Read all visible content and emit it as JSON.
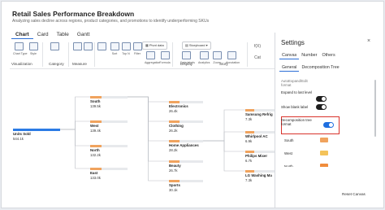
{
  "header": {
    "title": "Retail Sales Performance Breakdown",
    "subtitle": "Analyzing sales decline across regions, product categories, and promotions to identify underperforming SKUs"
  },
  "view_tabs": [
    "Chart",
    "Card",
    "Table",
    "Gantt"
  ],
  "toolbar": {
    "buttons": [
      "Chart Type",
      "Style",
      "Scale",
      "Sort",
      "Top N",
      "Filter",
      "Aggregation",
      "Formula",
      "Data labels",
      "Analytics",
      "Zoom",
      "Annotation"
    ],
    "groups": [
      "Visualization",
      "Category",
      "Measure",
      "Display",
      "Story"
    ],
    "pill_pivot": "Pivot data",
    "pill_storyboard": "Storyboard",
    "sort_label": "Sort",
    "conditional_label": "Conditional formatting"
  },
  "tree": {
    "root": {
      "name": "Units Sold",
      "value": "544.1k"
    },
    "level1": [
      {
        "name": "South",
        "value": "139.5k"
      },
      {
        "name": "West",
        "value": "139.4k"
      },
      {
        "name": "North",
        "value": "132.2k"
      },
      {
        "name": "East",
        "value": "133.0k"
      }
    ],
    "level2": [
      {
        "name": "Electronics",
        "value": "26.4k"
      },
      {
        "name": "Clothing",
        "value": "26.2k"
      },
      {
        "name": "Home Appliances",
        "value": "28.2k"
      },
      {
        "name": "Beauty",
        "value": "26.7k"
      },
      {
        "name": "Sports",
        "value": "30.1k"
      }
    ],
    "level3": [
      {
        "name": "Samsung Refrig",
        "value": "7.3k"
      },
      {
        "name": "Whirlpool AC",
        "value": "6.9k"
      },
      {
        "name": "Philips Mixer",
        "value": "6.7k"
      },
      {
        "name": "LG Washing Ma",
        "value": "7.3k"
      }
    ],
    "colors": {
      "root": "#2c7be5",
      "region": "#f0a35e",
      "category": "#f0a35e",
      "sku": "#f0a35e",
      "track": "#e7e9ec"
    }
  },
  "settings": {
    "title": "Settings",
    "close": "×",
    "tabs": [
      "Canvas",
      "Number",
      "Others"
    ],
    "subtabs": [
      "General",
      "Decomposition Tree"
    ],
    "rows": [
      {
        "label": "AutoExpand/Edit",
        "label2": "format"
      },
      {
        "label": "Expand to last level"
      },
      {
        "label": "Show blank label"
      },
      {
        "label": "Decomposition tree",
        "label2": "format"
      }
    ],
    "color_rows": [
      {
        "label": "South",
        "color": "#f0a35e"
      },
      {
        "label": "West",
        "color": "#f4c35a"
      },
      {
        "label": "North",
        "color": "#f08d3c"
      },
      {
        "label": "East",
        "color": "#e0603c"
      }
    ],
    "reset": "Reset Canvas"
  },
  "window_controls": {
    "fx": "f(X)",
    "cat": "Cat"
  }
}
